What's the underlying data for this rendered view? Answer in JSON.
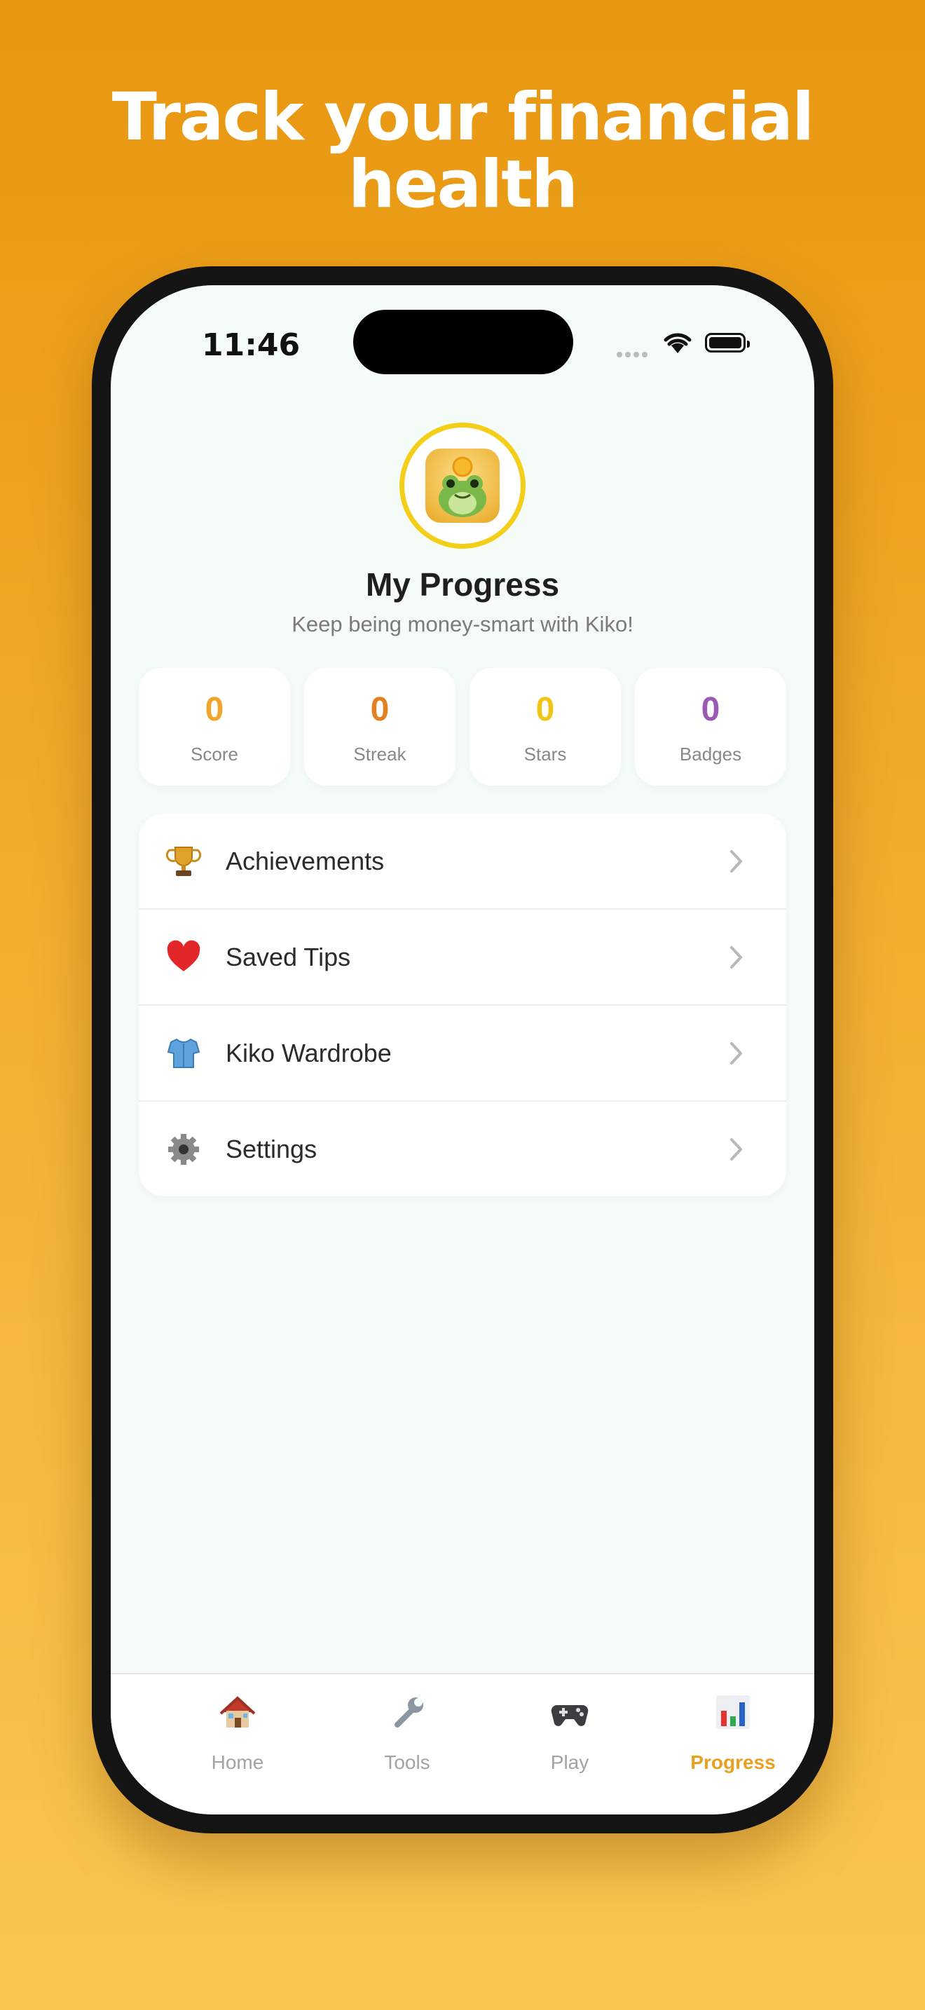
{
  "headline": "Track your financial health",
  "status_bar": {
    "time": "11:46"
  },
  "profile": {
    "title": "My Progress",
    "subtitle": "Keep being money-smart with Kiko!"
  },
  "stats": [
    {
      "value": "0",
      "label": "Score",
      "color": "#F0A62A"
    },
    {
      "value": "0",
      "label": "Streak",
      "color": "#E5801F"
    },
    {
      "value": "0",
      "label": "Stars",
      "color": "#F1C516"
    },
    {
      "value": "0",
      "label": "Badges",
      "color": "#9B59B6"
    }
  ],
  "menu": [
    {
      "label": "Achievements",
      "icon": "trophy-icon"
    },
    {
      "label": "Saved Tips",
      "icon": "heart-icon"
    },
    {
      "label": "Kiko Wardrobe",
      "icon": "shirt-icon"
    },
    {
      "label": "Settings",
      "icon": "gear-icon"
    }
  ],
  "tabs": [
    {
      "label": "Home",
      "icon": "house-icon"
    },
    {
      "label": "Tools",
      "icon": "wrench-icon"
    },
    {
      "label": "Play",
      "icon": "gamepad-icon"
    },
    {
      "label": "Progress",
      "icon": "bar-chart-icon",
      "active": true
    }
  ],
  "colors": {
    "accent": "#E9A021",
    "background": "#F5FBF6"
  }
}
